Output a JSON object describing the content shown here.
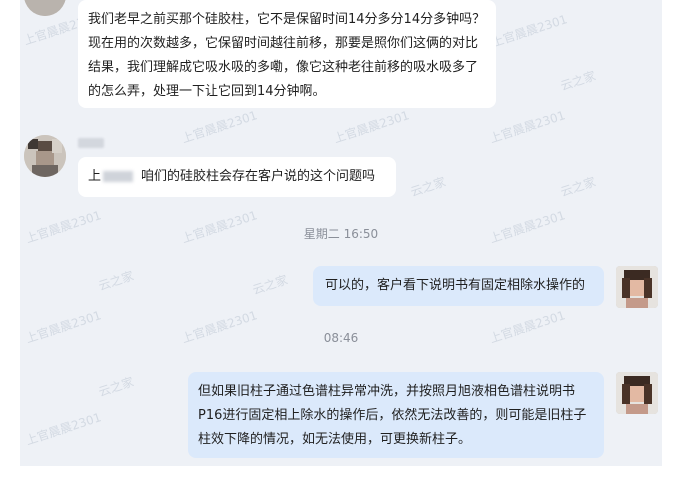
{
  "messages": {
    "m1": {
      "text": "我们老早之前买那个硅胶柱，它不是保留时间14分多分14分多钟吗？现在用的次数越多，它保留时间越往前移，那要是照你们这俩的对比结果，我们理解成它吸水吸的多嘞，像它这种老往前移的吸水吸多了的怎么弄，处理一下让它回到14分钟啊。"
    },
    "m2": {
      "prefix": "上",
      "text": "咱们的硅胶柱会存在客户说的这个问题吗"
    },
    "m3": {
      "text": "可以的，客户看下说明书有固定相除水操作的"
    },
    "m4": {
      "text": "但如果旧柱子通过色谱柱异常冲洗，并按照月旭液相色谱柱说明书P16进行固定相上除水的操作后，依然无法改善的，则可能是旧柱子柱效下降的情况，如无法使用，可更换新柱子。"
    }
  },
  "timestamps": {
    "t1": "星期二 16:50",
    "t2": "08:46"
  },
  "watermarks": {
    "a": "上官晨晨2301",
    "b": "云之家"
  },
  "colors": {
    "panel_bg": "#eef1f6",
    "left_bubble": "#ffffff",
    "right_bubble": "#dbe9fb",
    "text": "#1f1f1f",
    "time": "#8a8f99"
  }
}
